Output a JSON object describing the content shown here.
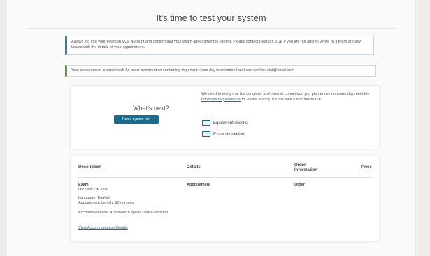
{
  "title": "It's time to test your system",
  "alerts": {
    "info": "Always log into your Pearson VUE account and confirm that your exam appointment is correct. Please contact Pearson VUE if you are not able to verify, or if there are any issues with the details of your appointment.",
    "success": "Your appointment is confirmed! An order confirmation containing important exam day information has been sent to: olaf@email.com"
  },
  "next": {
    "heading": "What's next?",
    "button": "Run a system test",
    "text_before": "We need to verify that the computer and internet connection you plan to use on exam day meet the",
    "link": "minimum requirements",
    "text_after": "for online testing. It's just take 5 minutes to run.",
    "checks": [
      "Equipment checks",
      "Exam simulation"
    ]
  },
  "order": {
    "headers": {
      "description": "Description",
      "details": "Details",
      "order_info": "Order Information",
      "price": "Price"
    },
    "row": {
      "exam_label": "Exam",
      "exam_name": "OP Test: OP Test",
      "language": "Language: English",
      "length": "Appointment Length: 90 minutes",
      "accommodations": "Accommodations: Automatic English Time Extension",
      "accommodation_link": "View Accommodation Details",
      "details": "Appointment",
      "order_info": "Order"
    }
  },
  "colors": {
    "accent": "#1a6b8c",
    "info_border": "#3a7d94",
    "success_border": "#5a9a3e"
  }
}
